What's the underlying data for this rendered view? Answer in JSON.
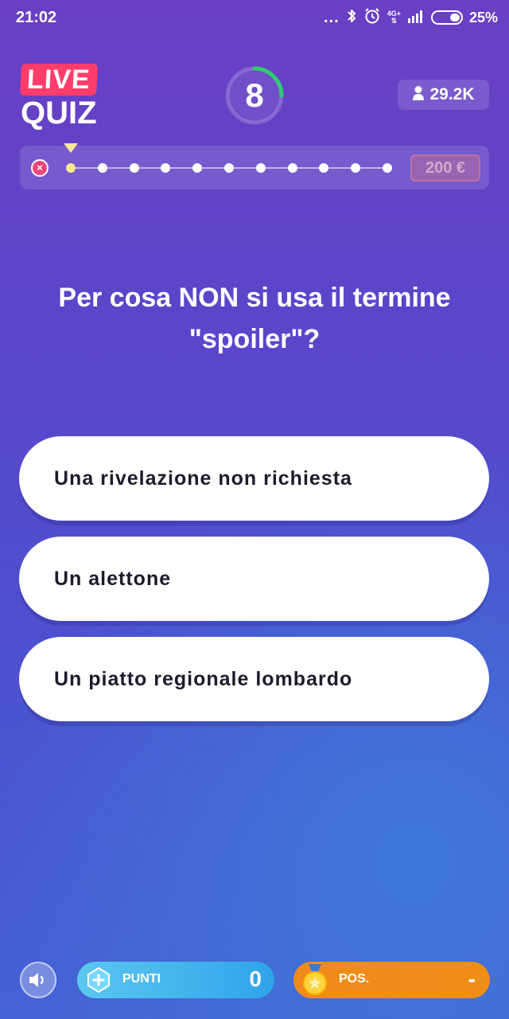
{
  "status_bar": {
    "time": "21:02",
    "dots": "...",
    "network_top": "4G+",
    "network_bottom": "⇅",
    "battery_percent": "25%"
  },
  "header": {
    "logo_live": "LIVE",
    "logo_quiz": "QUIZ",
    "timer_value": "8",
    "viewers_count": "29.2K"
  },
  "progress": {
    "total_steps": 11,
    "current_step": 1,
    "prize_label": "200 €",
    "lose_icon": "×"
  },
  "question": {
    "text": "Per cosa NON si usa il termine \"spoiler\"?"
  },
  "answers": [
    {
      "label": "Una rivelazione non richiesta"
    },
    {
      "label": "Un alettone"
    },
    {
      "label": "Un piatto regionale lombardo"
    }
  ],
  "footer": {
    "points_label": "PUNTI",
    "points_value": "0",
    "position_label": "POS.",
    "position_value": "-"
  },
  "colors": {
    "live_badge": "#ff3d6b",
    "timer_ring": "#2ecc71",
    "current_step_marker": "#f9e88e",
    "points_pill": "#2fa3ea",
    "position_pill": "#ee8f16"
  }
}
